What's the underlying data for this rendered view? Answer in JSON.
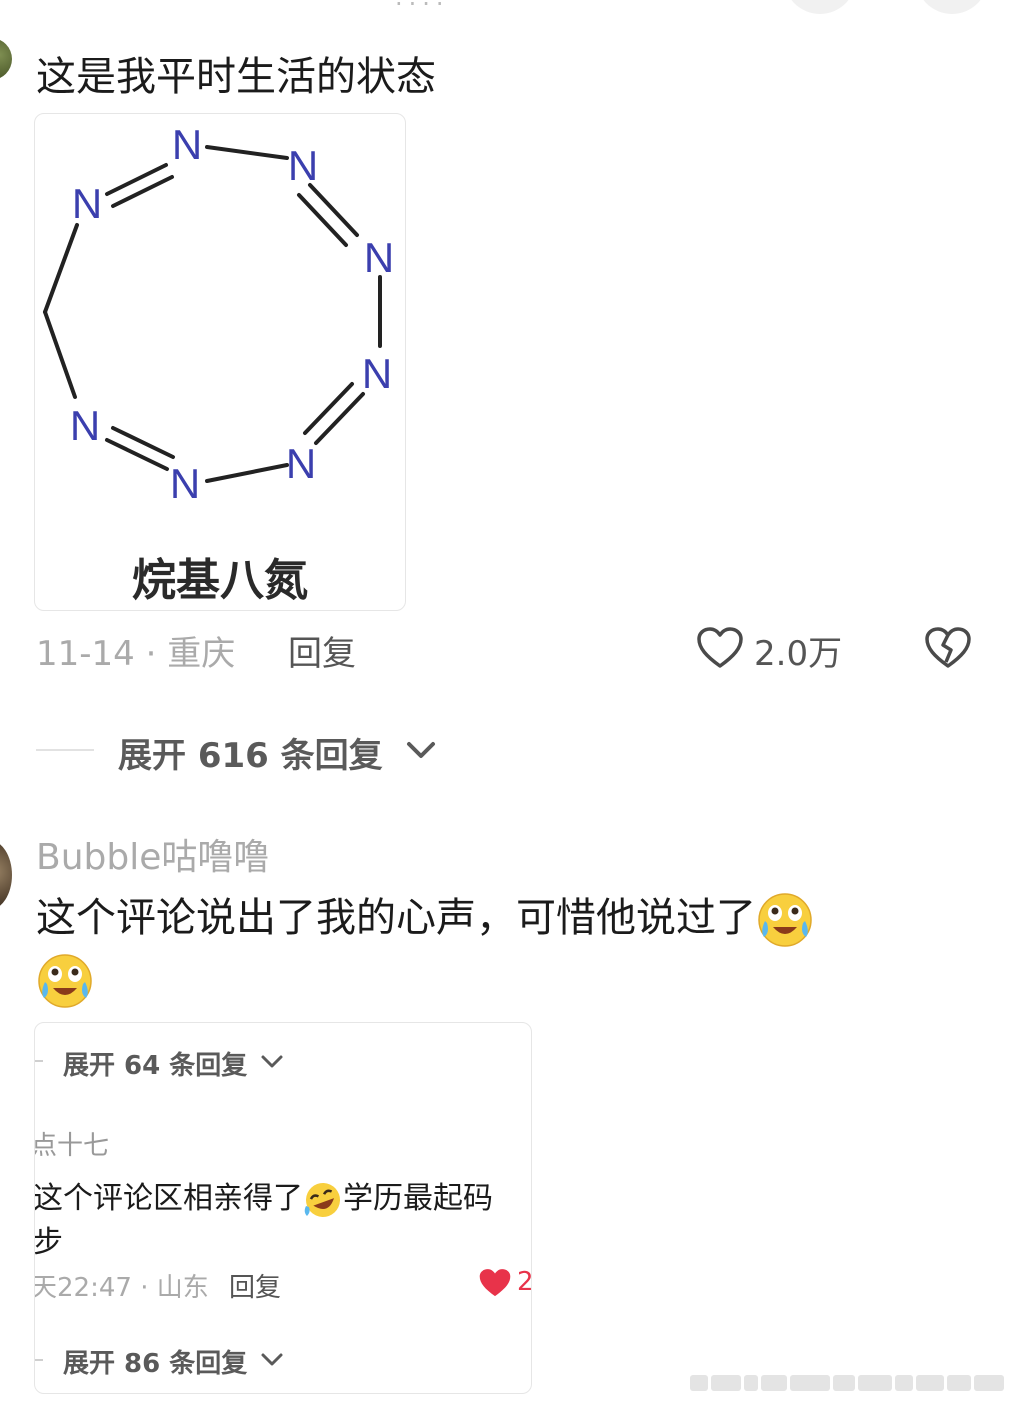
{
  "top": {
    "cut_title": "····",
    "circle_icons": [
      "more-icon",
      "share-icon"
    ]
  },
  "comment1": {
    "text": "这是我平时生活的状态",
    "image": {
      "atom_label": "N",
      "caption": "烷基八氮"
    },
    "date_location": "11-14 · 重庆",
    "reply_label": "回复",
    "like_count": "2.0万",
    "expand_label": "展开 616 条回复"
  },
  "comment2": {
    "username": "Bubble咕噜噜",
    "text": "这个评论说出了我的心声，可惜他说过了",
    "embedded_screenshot": {
      "expand_top": "展开 64 条回复",
      "username_fragment": "点十七",
      "text_line1": "这个评论区相亲得了",
      "text_line1_after": "学历最起码",
      "text_line2": "步",
      "time_location": "天22:47 · 山东",
      "reply_label": "回复",
      "like_count": "2",
      "expand_bottom": "展开 86 条回复"
    }
  },
  "colors": {
    "like_red": "#e8334a",
    "nitrogen_blue": "#3b3fae",
    "muted_text": "#aaaaaa"
  }
}
